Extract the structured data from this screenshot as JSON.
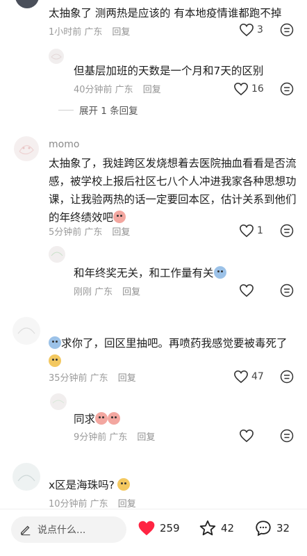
{
  "comments": [
    {
      "text": "太抽象了 测两热是应该的 有本地疫情谁都跑不掉",
      "time": "1小时前 广东",
      "reply": "回复",
      "likes": "3"
    },
    {
      "text": "但基层加班的天数是一个月和7天的区别",
      "time": "40分钟前 广东",
      "reply": "回复",
      "likes": "16"
    },
    {
      "expand": "展开 1 条回复"
    },
    {
      "name": "momo",
      "text_lines": [
        "太抽象了，我娃跨区发烧想着去医院抽血看看是否流",
        "感，被学校上报后社区七八个人冲进我家各种思想功",
        "课，让我验两热的话一定要回本区，估计关系到他们",
        "的年终绩效吧"
      ],
      "time": "5分钟前 广东",
      "reply": "回复",
      "likes": "1"
    },
    {
      "text": "和年终奖无关，和工作量有关",
      "time": "刚刚 广东",
      "reply": "回复",
      "likes": ""
    },
    {
      "text_lines": [
        "求你了，回区里抽吧。再喷药我感觉要被毒死了"
      ],
      "time": "35分钟前 广东",
      "reply": "回复",
      "likes": "47"
    },
    {
      "text": "同求",
      "time": "9分钟前 广东",
      "reply": "回复",
      "likes": ""
    },
    {
      "text": "x区是海珠吗?",
      "time": "10分钟前 广东",
      "reply": "回复"
    }
  ],
  "bottom": {
    "placeholder": "说点什么...",
    "likes": "259",
    "stars": "42",
    "comments": "32",
    "heart_color": "#ff2442"
  }
}
